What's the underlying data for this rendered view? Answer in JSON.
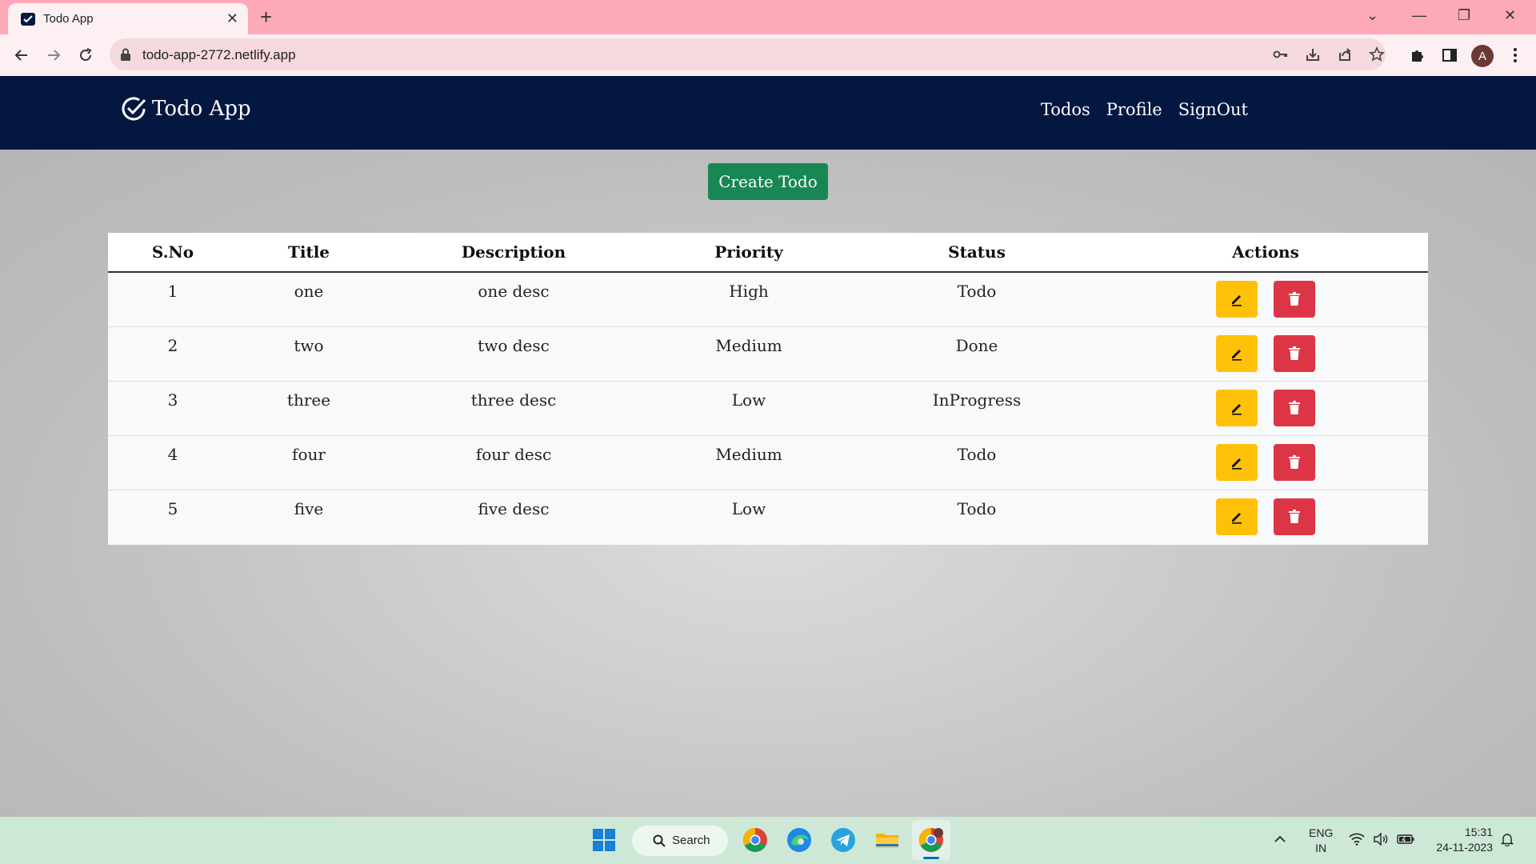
{
  "browser": {
    "tab_title": "Todo App",
    "tab_close": "✕",
    "new_tab": "+",
    "url": "todo-app-2772.netlify.app",
    "avatar_letter": "A",
    "window_controls": {
      "tab_search": "⌄",
      "minimize": "—",
      "restore": "❐",
      "close": "✕"
    }
  },
  "app": {
    "brand": "Todo App",
    "nav": [
      {
        "label": "Todos"
      },
      {
        "label": "Profile"
      },
      {
        "label": "SignOut"
      }
    ],
    "create_button": "Create Todo",
    "table": {
      "columns": [
        "S.No",
        "Title",
        "Description",
        "Priority",
        "Status",
        "Actions"
      ],
      "rows": [
        {
          "sno": "1",
          "title": "one",
          "description": "one desc",
          "priority": "High",
          "status": "Todo"
        },
        {
          "sno": "2",
          "title": "two",
          "description": "two desc",
          "priority": "Medium",
          "status": "Done"
        },
        {
          "sno": "3",
          "title": "three",
          "description": "three desc",
          "priority": "Low",
          "status": "InProgress"
        },
        {
          "sno": "4",
          "title": "four",
          "description": "four desc",
          "priority": "Medium",
          "status": "Todo"
        },
        {
          "sno": "5",
          "title": "five",
          "description": "five desc",
          "priority": "Low",
          "status": "Todo"
        }
      ]
    }
  },
  "colors": {
    "navbar": "#031741",
    "create_button": "#198754",
    "edit_button": "#ffc107",
    "delete_button": "#dc3545",
    "tabstrip": "#fda9b8"
  },
  "taskbar": {
    "search_label": "Search",
    "language": "ENG",
    "region": "IN",
    "time": "15:31",
    "date": "24-11-2023",
    "apps": [
      "chrome-icon",
      "edge-icon",
      "telegram-icon",
      "file-explorer-icon",
      "chrome-profile-icon"
    ]
  }
}
